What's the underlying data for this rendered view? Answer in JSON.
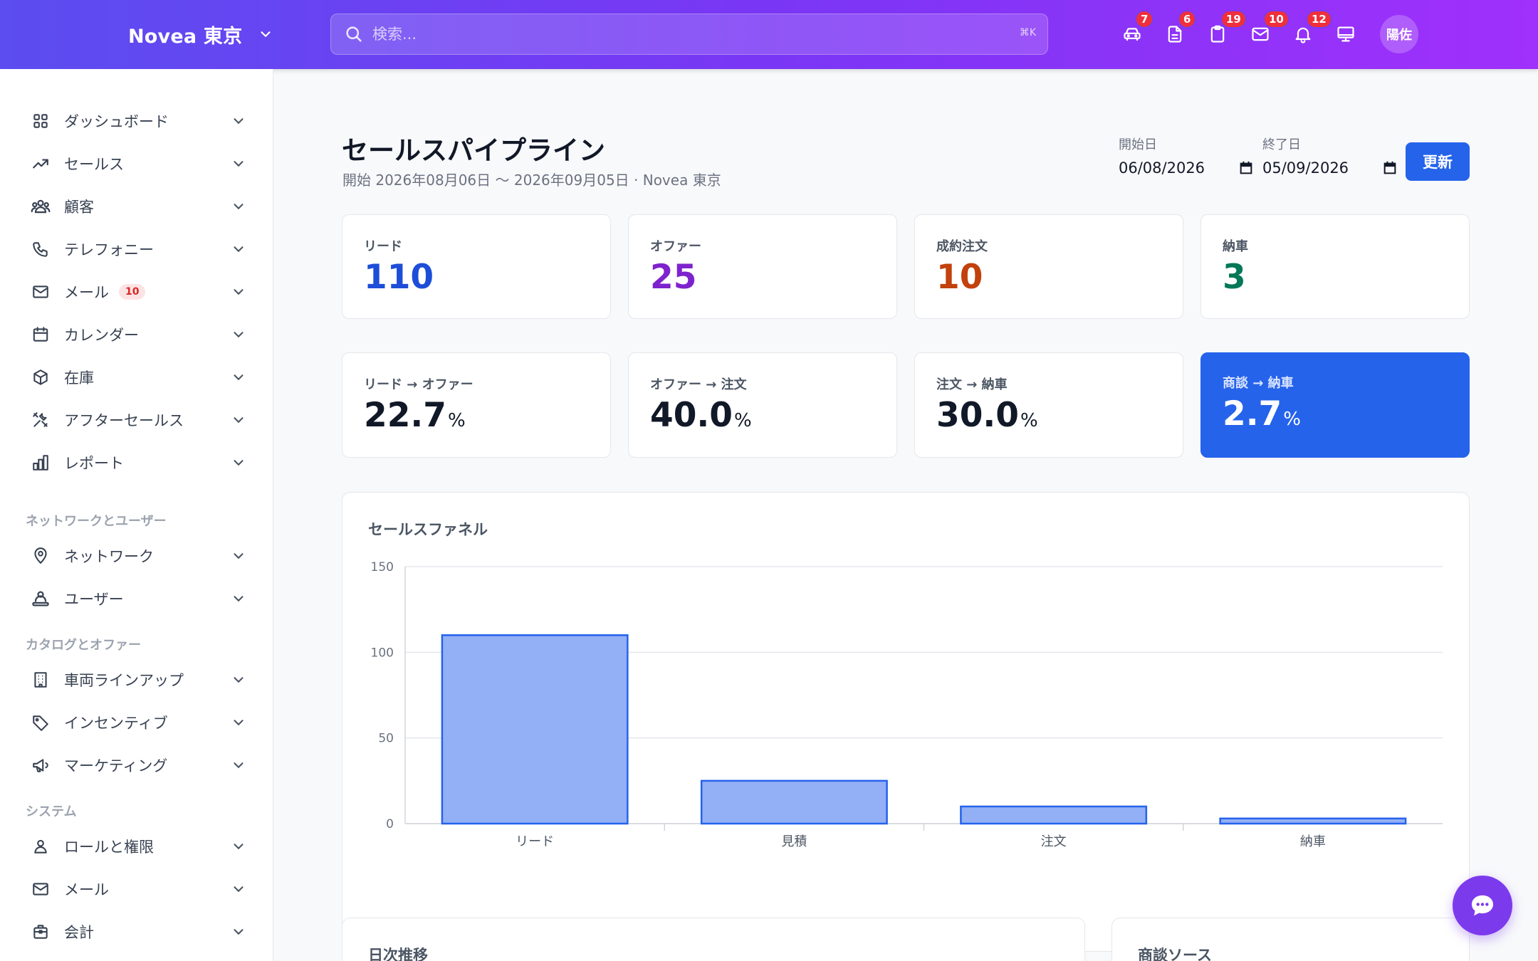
{
  "topbar": {
    "brand": "Novea 東京",
    "search_placeholder": "検索...",
    "search_shortcut": "⌘K",
    "icons": [
      {
        "name": "car-icon",
        "badge": "7"
      },
      {
        "name": "document-icon",
        "badge": "6"
      },
      {
        "name": "clipboard-icon",
        "badge": "19"
      },
      {
        "name": "mail-icon",
        "badge": "10"
      },
      {
        "name": "bell-icon",
        "badge": "12"
      },
      {
        "name": "monitor-icon",
        "badge": ""
      }
    ],
    "avatar": "陽佐"
  },
  "sidebar": {
    "items": [
      {
        "label": "ダッシュボード",
        "icon": "grid-icon"
      },
      {
        "label": "セールス",
        "icon": "trending-up-icon"
      },
      {
        "label": "顧客",
        "icon": "users-icon"
      },
      {
        "label": "テレフォニー",
        "icon": "phone-icon"
      },
      {
        "label": "メール",
        "icon": "mail-icon",
        "badge": "10"
      },
      {
        "label": "カレンダー",
        "icon": "calendar-icon"
      },
      {
        "label": "在庫",
        "icon": "box-icon"
      },
      {
        "label": "アフターセールス",
        "icon": "tools-icon"
      },
      {
        "label": "レポート",
        "icon": "bar-chart-icon"
      }
    ],
    "section_network": "ネットワークとユーザー",
    "network_items": [
      {
        "label": "ネットワーク",
        "icon": "map-pin-icon"
      },
      {
        "label": "ユーザー",
        "icon": "user-group-icon"
      }
    ],
    "section_catalog": "カタログとオファー",
    "catalog_items": [
      {
        "label": "車両ラインアップ",
        "icon": "building-icon"
      },
      {
        "label": "インセンティブ",
        "icon": "tag-icon"
      },
      {
        "label": "マーケティング",
        "icon": "megaphone-icon"
      }
    ],
    "section_system": "システム",
    "system_items": [
      {
        "label": "ロールと権限",
        "icon": "user-icon"
      },
      {
        "label": "メール",
        "icon": "mail-icon"
      },
      {
        "label": "会計",
        "icon": "briefcase-icon"
      }
    ]
  },
  "header": {
    "title": "セールスパイプライン",
    "subtitle": "開始 2026年08月06日 〜 2026年09月05日 · Novea 東京",
    "start_label": "開始日",
    "start_value": "06/08/2026",
    "end_label": "終了日",
    "end_value": "05/09/2026",
    "update_button": "更新"
  },
  "kpis": [
    {
      "label": "リード",
      "value": "110",
      "color": "#1d4ed8"
    },
    {
      "label": "オファー",
      "value": "25",
      "color": "#7e22ce"
    },
    {
      "label": "成約注文",
      "value": "10",
      "color": "#c2410c"
    },
    {
      "label": "納車",
      "value": "3",
      "color": "#047857"
    }
  ],
  "conversions": [
    {
      "label": "リード → オファー",
      "value": "22.7",
      "unit": "%"
    },
    {
      "label": "オファー → 注文",
      "value": "40.0",
      "unit": "%"
    },
    {
      "label": "注文 → 納車",
      "value": "30.0",
      "unit": "%"
    },
    {
      "label": "商談 → 納車",
      "value": "2.7",
      "unit": "%"
    }
  ],
  "funnel_panel": {
    "title": "セールスファネル"
  },
  "chart_data": {
    "type": "bar",
    "title": "セールスファネル",
    "categories": [
      "リード",
      "見積",
      "注文",
      "納車"
    ],
    "values": [
      110,
      25,
      10,
      3
    ],
    "ylim": [
      0,
      150
    ],
    "yticks": [
      0,
      50,
      100,
      150
    ],
    "grid": true,
    "bar_color": "#93aff5",
    "bar_border": "#2563eb"
  },
  "bottom_panels": {
    "daily": "日次推移",
    "sources": "商談ソース"
  }
}
